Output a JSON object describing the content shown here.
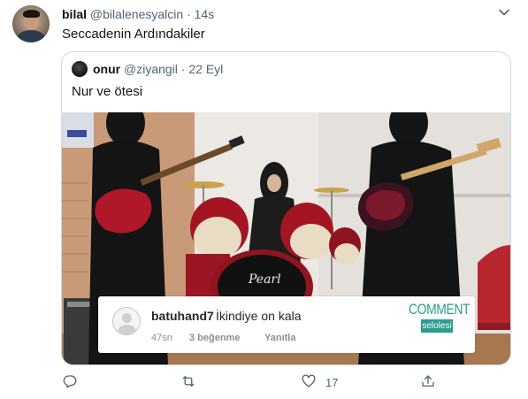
{
  "tweet": {
    "display_name": "bilal",
    "handle": "@bilalenesyalcin",
    "separator": "·",
    "time": "14s",
    "text": "Seccadenin Ardındakiler"
  },
  "quoted_tweet": {
    "display_name": "onur",
    "handle": "@ziyangil",
    "separator": "·",
    "time": "22 Eyl",
    "text": "Nur ve ötesi",
    "photo": {
      "drum_brand": "Pearl",
      "overlay_comment": {
        "username": "batuhand7",
        "text": "İkindiye on kala",
        "time": "47sn",
        "likes": "3 beğenme",
        "reply_label": "Yanıtla"
      },
      "logo": {
        "top": "COMMENT",
        "bottom": "selolesi"
      }
    }
  },
  "actions": {
    "reply_icon": "reply-icon",
    "retweet_icon": "retweet-icon",
    "like_icon": "heart-icon",
    "like_count": "17",
    "share_icon": "share-icon"
  },
  "colors": {
    "accent": "#1d9bf0",
    "secondary_text": "#536471",
    "border": "#cfd9de",
    "comment_logo": "#2a9d8f"
  }
}
